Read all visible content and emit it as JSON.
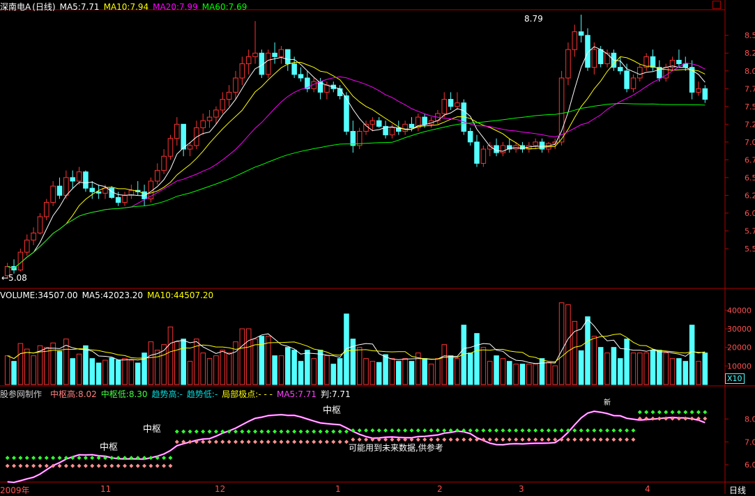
{
  "header": {
    "title": "深南电A",
    "period": "(日线)",
    "ma5": "MA5:7.71",
    "ma10": "MA10:7.94",
    "ma20": "MA20:7.99",
    "ma60": "MA60:7.69"
  },
  "volume_header": {
    "volume": "VOLUME:34507.00",
    "ma5": "MA5:42023.20",
    "ma10": "MA10:44507.20"
  },
  "indicator_header": {
    "name": "股参网制作",
    "zs_high": "中枢高:8.02",
    "zs_low": "中枢低:8.30",
    "trend_high": "趋势高:-",
    "trend_low": "趋势低:-",
    "local_extreme": "局部极点:-  -  -",
    "ma5": "MA5:7.71",
    "judge": "判:7.71"
  },
  "annotations": {
    "high_label": "8.79",
    "low_label": "←5.08",
    "zhongshu": "中枢",
    "future_note": "可能用到未来数据,供参考",
    "x10": "X10",
    "tag_new": "新"
  },
  "x_axis": [
    "2009年",
    "11",
    "12",
    "1",
    "2",
    "3",
    "4"
  ],
  "price_ticks": [
    "8.50",
    "8.25",
    "8.00",
    "7.75",
    "7.50",
    "7.25",
    "7.00",
    "6.75",
    "6.50",
    "6.25",
    "6.00",
    "5.75",
    "5.50"
  ],
  "volume_ticks": [
    "40000",
    "30000",
    "20000",
    "10000"
  ],
  "ind_ticks": [
    "8.00",
    "7.00",
    "6.00"
  ],
  "status_tab": "日线",
  "colors": {
    "up": "#ff3232",
    "down": "#54ffff",
    "ma5": "#ffffff",
    "ma10": "#ffff00",
    "ma20": "#ff00ff",
    "ma60": "#00ff00",
    "grid": "#b00000"
  },
  "chart_data": {
    "type": "candlestick",
    "ohlc": [
      [
        5.12,
        5.3,
        5.08,
        5.25
      ],
      [
        5.25,
        5.35,
        5.15,
        5.2
      ],
      [
        5.2,
        5.5,
        5.18,
        5.45
      ],
      [
        5.45,
        5.7,
        5.4,
        5.62
      ],
      [
        5.62,
        5.8,
        5.55,
        5.72
      ],
      [
        5.72,
        6.0,
        5.7,
        5.95
      ],
      [
        5.95,
        6.2,
        5.9,
        6.15
      ],
      [
        6.15,
        6.45,
        6.1,
        6.38
      ],
      [
        6.38,
        6.5,
        6.2,
        6.25
      ],
      [
        6.25,
        6.6,
        6.2,
        6.5
      ],
      [
        6.5,
        6.6,
        6.35,
        6.45
      ],
      [
        6.45,
        6.65,
        6.4,
        6.58
      ],
      [
        6.58,
        6.6,
        6.3,
        6.35
      ],
      [
        6.35,
        6.45,
        6.2,
        6.3
      ],
      [
        6.3,
        6.4,
        6.2,
        6.28
      ],
      [
        6.28,
        6.4,
        6.2,
        6.35
      ],
      [
        6.35,
        6.38,
        6.2,
        6.22
      ],
      [
        6.22,
        6.3,
        6.1,
        6.15
      ],
      [
        6.15,
        6.3,
        6.1,
        6.25
      ],
      [
        6.25,
        6.4,
        6.2,
        6.32
      ],
      [
        6.32,
        6.45,
        6.25,
        6.3
      ],
      [
        6.3,
        6.4,
        6.1,
        6.2
      ],
      [
        6.2,
        6.5,
        6.15,
        6.45
      ],
      [
        6.45,
        6.7,
        6.4,
        6.6
      ],
      [
        6.6,
        6.9,
        6.55,
        6.8
      ],
      [
        6.8,
        7.1,
        6.75,
        7.05
      ],
      [
        7.05,
        7.35,
        6.95,
        7.25
      ],
      [
        7.25,
        7.1,
        6.8,
        6.9
      ],
      [
        6.9,
        7.0,
        6.8,
        6.95
      ],
      [
        6.95,
        7.3,
        6.9,
        7.2
      ],
      [
        7.2,
        7.4,
        7.1,
        7.3
      ],
      [
        7.3,
        7.45,
        7.2,
        7.35
      ],
      [
        7.35,
        7.5,
        7.25,
        7.45
      ],
      [
        7.45,
        7.7,
        7.4,
        7.6
      ],
      [
        7.6,
        7.8,
        7.5,
        7.7
      ],
      [
        7.7,
        8.0,
        7.6,
        7.9
      ],
      [
        7.9,
        8.2,
        7.8,
        8.1
      ],
      [
        8.1,
        8.3,
        7.95,
        8.2
      ],
      [
        8.2,
        8.7,
        8.1,
        8.25
      ],
      [
        8.25,
        8.3,
        7.9,
        7.95
      ],
      [
        7.95,
        8.3,
        7.9,
        8.25
      ],
      [
        8.25,
        8.4,
        8.1,
        8.2
      ],
      [
        8.2,
        8.35,
        8.1,
        8.3
      ],
      [
        8.3,
        8.3,
        8.0,
        8.1
      ],
      [
        8.1,
        8.2,
        7.9,
        7.95
      ],
      [
        7.95,
        8.05,
        7.85,
        7.9
      ],
      [
        7.9,
        8.0,
        7.7,
        7.75
      ],
      [
        7.75,
        7.9,
        7.7,
        7.85
      ],
      [
        7.85,
        7.9,
        7.6,
        7.7
      ],
      [
        7.7,
        7.85,
        7.6,
        7.8
      ],
      [
        7.8,
        7.85,
        7.7,
        7.75
      ],
      [
        7.75,
        7.8,
        7.6,
        7.65
      ],
      [
        7.65,
        7.7,
        7.1,
        7.15
      ],
      [
        7.15,
        7.3,
        6.85,
        6.95
      ],
      [
        6.95,
        7.2,
        6.9,
        7.15
      ],
      [
        7.15,
        7.3,
        7.1,
        7.25
      ],
      [
        7.25,
        7.35,
        7.15,
        7.3
      ],
      [
        7.3,
        7.35,
        7.2,
        7.22
      ],
      [
        7.22,
        7.3,
        7.05,
        7.1
      ],
      [
        7.1,
        7.25,
        7.05,
        7.2
      ],
      [
        7.2,
        7.3,
        7.1,
        7.15
      ],
      [
        7.15,
        7.3,
        7.1,
        7.25
      ],
      [
        7.25,
        7.35,
        7.15,
        7.2
      ],
      [
        7.2,
        7.4,
        7.15,
        7.35
      ],
      [
        7.35,
        7.4,
        7.2,
        7.25
      ],
      [
        7.25,
        7.35,
        7.2,
        7.3
      ],
      [
        7.3,
        7.45,
        7.25,
        7.4
      ],
      [
        7.4,
        7.7,
        7.35,
        7.6
      ],
      [
        7.6,
        7.7,
        7.45,
        7.5
      ],
      [
        7.5,
        7.7,
        7.45,
        7.55
      ],
      [
        7.55,
        7.6,
        7.1,
        7.15
      ],
      [
        7.15,
        7.2,
        6.95,
        7.0
      ],
      [
        7.0,
        7.1,
        6.65,
        6.7
      ],
      [
        6.7,
        6.95,
        6.65,
        6.9
      ],
      [
        6.9,
        7.0,
        6.8,
        6.95
      ],
      [
        6.95,
        7.05,
        6.8,
        6.85
      ],
      [
        6.85,
        7.0,
        6.8,
        6.95
      ],
      [
        6.95,
        7.05,
        6.85,
        6.9
      ],
      [
        6.9,
        7.0,
        6.85,
        6.95
      ],
      [
        6.95,
        7.0,
        6.85,
        6.9
      ],
      [
        6.9,
        7.0,
        6.85,
        6.95
      ],
      [
        6.95,
        7.05,
        6.9,
        7.0
      ],
      [
        7.0,
        7.05,
        6.85,
        6.9
      ],
      [
        6.9,
        7.0,
        6.85,
        6.98
      ],
      [
        6.98,
        7.05,
        6.9,
        7.0
      ],
      [
        7.0,
        8.0,
        6.95,
        7.9
      ],
      [
        7.9,
        8.4,
        7.8,
        8.3
      ],
      [
        8.3,
        8.65,
        8.2,
        8.55
      ],
      [
        8.55,
        8.79,
        8.4,
        8.5
      ],
      [
        8.5,
        8.6,
        8.0,
        8.05
      ],
      [
        8.05,
        8.4,
        7.95,
        8.3
      ],
      [
        8.3,
        8.35,
        8.05,
        8.1
      ],
      [
        8.1,
        8.3,
        8.05,
        8.25
      ],
      [
        8.25,
        8.3,
        8.0,
        8.05
      ],
      [
        8.05,
        8.2,
        7.95,
        8.0
      ],
      [
        8.0,
        8.1,
        7.7,
        7.75
      ],
      [
        7.75,
        7.95,
        7.7,
        7.9
      ],
      [
        7.9,
        8.1,
        7.85,
        8.05
      ],
      [
        8.05,
        8.25,
        8.0,
        8.2
      ],
      [
        8.2,
        8.3,
        8.0,
        8.05
      ],
      [
        8.05,
        8.15,
        7.85,
        7.9
      ],
      [
        7.9,
        8.1,
        7.85,
        8.05
      ],
      [
        8.05,
        8.2,
        8.0,
        8.15
      ],
      [
        8.15,
        8.3,
        8.05,
        8.1
      ],
      [
        8.1,
        8.2,
        8.0,
        8.05
      ],
      [
        8.05,
        8.15,
        7.6,
        7.7
      ],
      [
        7.7,
        7.85,
        7.65,
        7.75
      ],
      [
        7.75,
        7.8,
        7.55,
        7.6
      ]
    ],
    "volume_ylim": [
      0,
      45000
    ],
    "price_ylim": [
      5.0,
      8.85
    ],
    "ma60_at_end": 7.69
  }
}
